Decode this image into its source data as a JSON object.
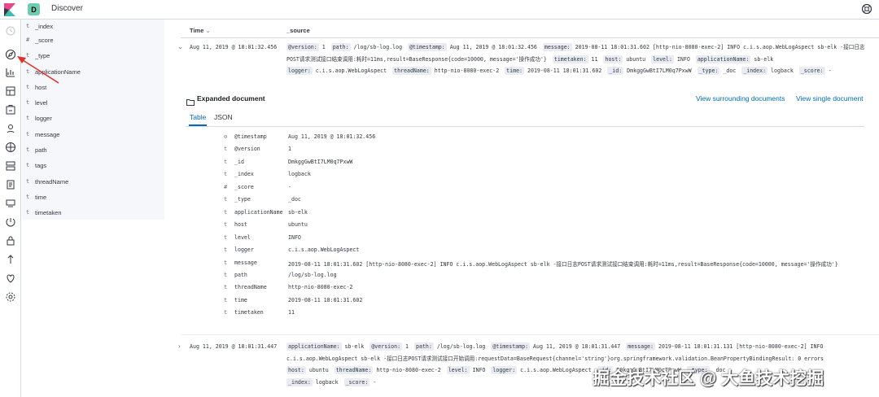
{
  "header": {
    "space_badge": "D",
    "app_title": "Discover"
  },
  "nav": {
    "icons": [
      "recent-icon",
      "discover-icon",
      "visualize-icon",
      "dashboard-icon",
      "canvas-icon",
      "maps-icon",
      "ml-icon",
      "infrastructure-icon",
      "logs-icon",
      "uptime-icon",
      "apm-icon",
      "siem-icon",
      "dev-tools-icon",
      "monitoring-icon",
      "management-icon"
    ]
  },
  "sidebar": {
    "fields": [
      {
        "type": "t",
        "name": "_index"
      },
      {
        "type": "#",
        "name": "_score"
      },
      {
        "type": "t",
        "name": "_type"
      },
      {
        "type": "t",
        "name": "applicationName"
      },
      {
        "type": "t",
        "name": "host"
      },
      {
        "type": "t",
        "name": "level"
      },
      {
        "type": "t",
        "name": "logger"
      },
      {
        "type": "t",
        "name": "message"
      },
      {
        "type": "t",
        "name": "path"
      },
      {
        "type": "t",
        "name": "tags"
      },
      {
        "type": "t",
        "name": "threadName"
      },
      {
        "type": "t",
        "name": "time"
      },
      {
        "type": "t",
        "name": "timetaken"
      }
    ]
  },
  "table": {
    "col_time": "Time",
    "col_time_sort": "⌄",
    "col_source": "_source"
  },
  "rows": [
    {
      "time": "Aug 11, 2019 @ 18:01:32.456",
      "source": [
        [
          [
            "@version:",
            "1"
          ],
          [
            "path:",
            "/log/sb-log.log"
          ],
          [
            "@timestamp:",
            "Aug 11, 2019 @ 18:01:32.456"
          ],
          [
            "message:",
            "2019-08-11 18:01:31.602 [http-nio-8080-exec-2] INFO c.i.s.aop.WebLogAspect sb-elk -接口日志"
          ]
        ],
        [
          [
            "",
            "POST请求测试接口结束调用:耗时=11ms,result=BaseResponse{code=10000, message='操作成功'}"
          ],
          [
            "timetaken:",
            "11"
          ],
          [
            "host:",
            "ubuntu"
          ],
          [
            "level:",
            "INFO"
          ],
          [
            "applicationName:",
            "sb-elk"
          ]
        ],
        [
          [
            "logger:",
            "c.i.s.aop.WebLogAspect"
          ],
          [
            "threadName:",
            "http-nio-8080-exec-2"
          ],
          [
            "time:",
            "2019-08-11 18:01:31.602"
          ],
          [
            "_id:",
            "DmkggGwBtI7LM0q7PxwW"
          ],
          [
            "_type:",
            "_doc"
          ],
          [
            "_index:",
            "logback"
          ],
          [
            "_score:",
            "-"
          ]
        ]
      ]
    },
    {
      "time": "Aug 11, 2019 @ 18:01:31.447",
      "source": [
        [
          [
            "applicationName:",
            "sb-elk"
          ],
          [
            "@version:",
            "1"
          ],
          [
            "path:",
            "/log/sb-log.log"
          ],
          [
            "@timestamp:",
            "Aug 11, 2019 @ 18:01:31.447"
          ],
          [
            "message:",
            "2019-08-11 18:01:31.131 [http-nio-8080-exec-2] INFO"
          ]
        ],
        [
          [
            "",
            "c.i.s.aop.WebLogAspect sb-elk -接口日志POST请求测试接口开始调用:requestData=BaseRequest{channel='string'}org.springframework.validation.BeanPropertyBindingResult: 0 errors"
          ]
        ],
        [
          [
            "host:",
            "ubuntu"
          ],
          [
            "threadName:",
            "http-nio-8080-exec-2"
          ],
          [
            "level:",
            "INFO"
          ],
          [
            "logger:",
            "c.i.s.aop.WebLogAspect"
          ],
          [
            "_id:",
            "D0kggGwBtI7LM0q7PxwW"
          ],
          [
            "_type:",
            "_doc"
          ]
        ],
        [
          [
            "_index:",
            "logback"
          ],
          [
            "_score:",
            "-"
          ]
        ]
      ]
    }
  ],
  "expanded": {
    "title": "Expanded document",
    "link_surrounding": "View surrounding documents",
    "link_single": "View single document",
    "tab_table": "Table",
    "tab_json": "JSON",
    "fields": [
      {
        "type": "⊙",
        "key": "@timestamp",
        "value": "Aug 11, 2019 @ 18:01:32.456"
      },
      {
        "type": "t",
        "key": "@version",
        "value": "1"
      },
      {
        "type": "t",
        "key": "_id",
        "value": "DmkggGwBtI7LM0q7PxwW"
      },
      {
        "type": "t",
        "key": "_index",
        "value": "logback"
      },
      {
        "type": "#",
        "key": "_score",
        "value": " -"
      },
      {
        "type": "t",
        "key": "_type",
        "value": "_doc"
      },
      {
        "type": "t",
        "key": "applicationName",
        "value": "sb-elk"
      },
      {
        "type": "t",
        "key": "host",
        "value": "ubuntu"
      },
      {
        "type": "t",
        "key": "level",
        "value": "INFO"
      },
      {
        "type": "t",
        "key": "logger",
        "value": "c.i.s.aop.WebLogAspect"
      },
      {
        "type": "t",
        "key": "message",
        "value": "2019-08-11 18:01:31.602 [http-nio-8080-exec-2] INFO  c.i.s.aop.WebLogAspect sb-elk -接口日志POST请求测试接口结束调用:耗时=11ms,result=BaseResponse{code=10000, message='操作成功'}"
      },
      {
        "type": "t",
        "key": "path",
        "value": "/log/sb-log.log"
      },
      {
        "type": "t",
        "key": "threadName",
        "value": "http-nio-8080-exec-2"
      },
      {
        "type": "t",
        "key": "time",
        "value": "2019-08-11 18:01:31.602"
      },
      {
        "type": "t",
        "key": "timetaken",
        "value": "11"
      }
    ]
  },
  "watermark": "掘金技术社区 @ 大鱼技术挖掘",
  "colors": {
    "accent": "#006bb4",
    "annotation_arrow": "#e0312a",
    "space_badge": "#6dccb1"
  }
}
